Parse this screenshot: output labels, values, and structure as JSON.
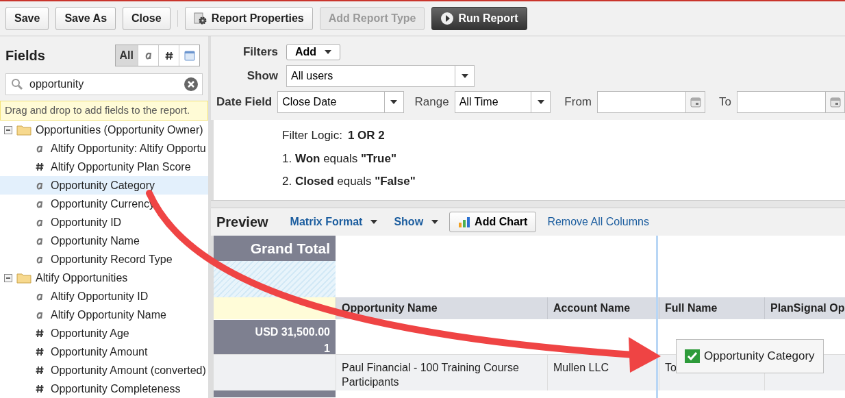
{
  "toolbar": {
    "buttons": [
      {
        "label": "Save",
        "kind": "plain",
        "disabled": false
      },
      {
        "label": "Save As",
        "kind": "plain",
        "disabled": false
      },
      {
        "label": "Close",
        "kind": "plain",
        "disabled": false
      },
      {
        "label": "Report Properties",
        "kind": "gear",
        "disabled": false
      },
      {
        "label": "Add Report Type",
        "kind": "plain",
        "disabled": true
      },
      {
        "label": "Run Report",
        "kind": "run",
        "disabled": false
      }
    ]
  },
  "fields_panel": {
    "title": "Fields",
    "type_filters": [
      {
        "kind": "all",
        "label": "All",
        "selected": true
      },
      {
        "kind": "text",
        "selected": false
      },
      {
        "kind": "number",
        "selected": false
      },
      {
        "kind": "date",
        "selected": false
      }
    ],
    "search": {
      "value": "opportunity"
    },
    "hint": "Drag and drop to add fields to the report.",
    "tree": [
      {
        "label": "Opportunities (Opportunity Owner)",
        "expanded": true,
        "children": [
          {
            "label": "Altify Opportunity: Altify Opportu",
            "kind": "text",
            "selected": false
          },
          {
            "label": "Altify Opportunity Plan Score",
            "kind": "number",
            "selected": false
          },
          {
            "label": "Opportunity Category",
            "kind": "text",
            "selected": true
          },
          {
            "label": "Opportunity Currency",
            "kind": "text",
            "selected": false
          },
          {
            "label": "Opportunity ID",
            "kind": "text",
            "selected": false
          },
          {
            "label": "Opportunity Name",
            "kind": "text",
            "selected": false
          },
          {
            "label": "Opportunity Record Type",
            "kind": "text",
            "selected": false
          }
        ]
      },
      {
        "label": "Altify Opportunities",
        "expanded": true,
        "children": [
          {
            "label": "Altify Opportunity ID",
            "kind": "text",
            "selected": false
          },
          {
            "label": "Altify Opportunity Name",
            "kind": "text",
            "selected": false
          },
          {
            "label": "Opportunity Age",
            "kind": "number",
            "selected": false
          },
          {
            "label": "Opportunity Amount",
            "kind": "number",
            "selected": false
          },
          {
            "label": "Opportunity Amount (converted)",
            "kind": "number",
            "selected": false
          },
          {
            "label": "Opportunity Completeness",
            "kind": "number",
            "selected": false
          }
        ]
      }
    ]
  },
  "filters": {
    "filters_label": "Filters",
    "add_button": "Add",
    "show_label": "Show",
    "show_value": "All users",
    "date_field_label": "Date Field",
    "date_field_value": "Close Date",
    "range_label": "Range",
    "range_value": "All Time",
    "from_label": "From",
    "to_label": "To",
    "logic_label": "Filter Logic:",
    "logic_value": "1 OR 2",
    "conditions": [
      "1. **Won** equals **\"True\"**",
      "2. **Closed** equals **\"False\"**"
    ]
  },
  "preview": {
    "title": "Preview",
    "links": [
      {
        "label": "Matrix Format",
        "dropdown": true
      },
      {
        "label": "Show",
        "dropdown": true
      }
    ],
    "add_chart": "Add Chart",
    "remove_all": "Remove All Columns",
    "grand_total": "Grand Total",
    "columns": [
      "Opportunity Name",
      "Account Name",
      "Full Name",
      "PlanSignal Op"
    ],
    "group": {
      "amount": "USD 31,500.00",
      "count": "1"
    },
    "row": [
      "Paul Financial - 100 Training Course Participants",
      "Mullen LLC",
      "To"
    ]
  },
  "drag_tooltip": {
    "label": "Opportunity Category"
  }
}
